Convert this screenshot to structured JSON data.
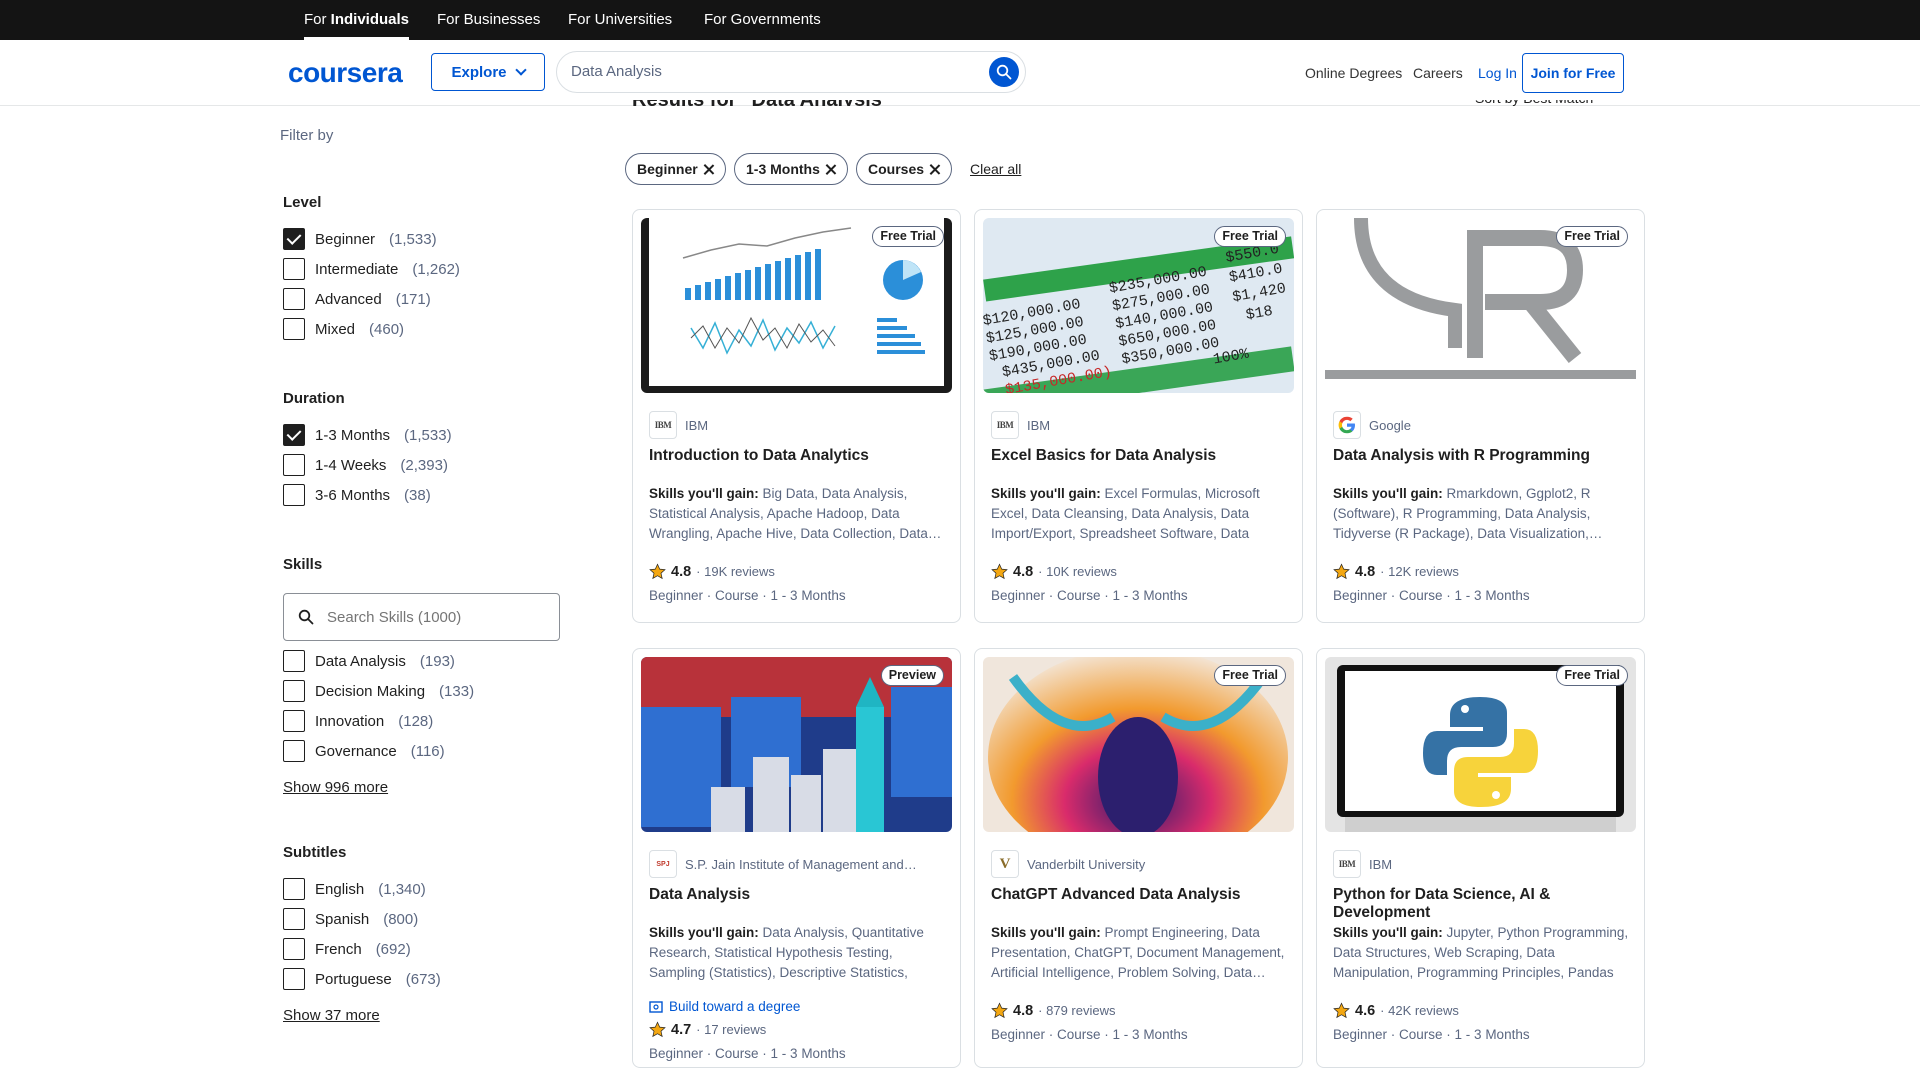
{
  "audience_tabs": [
    {
      "prefix": "For ",
      "bold": "Individuals"
    },
    {
      "label": "For Businesses"
    },
    {
      "label": "For Universities"
    },
    {
      "label": "For Governments"
    }
  ],
  "header": {
    "logo": "coursera",
    "explore": "Explore",
    "search_value": "Data Analysis",
    "links": [
      "Online Degrees",
      "Careers",
      "Log In"
    ],
    "join": "Join for Free"
  },
  "results": {
    "title": "Results for \"Data Analysis\"",
    "sort": "Sort by Best Match"
  },
  "sidebar": {
    "filter_by": "Filter by",
    "level": {
      "title": "Level",
      "options": [
        {
          "label": "Beginner",
          "count": "(1,533)",
          "checked": true
        },
        {
          "label": "Intermediate",
          "count": "(1,262)",
          "checked": false
        },
        {
          "label": "Advanced",
          "count": "(171)",
          "checked": false
        },
        {
          "label": "Mixed",
          "count": "(460)",
          "checked": false
        }
      ]
    },
    "duration": {
      "title": "Duration",
      "options": [
        {
          "label": "1-3 Months",
          "count": "(1,533)",
          "checked": true
        },
        {
          "label": "1-4 Weeks",
          "count": "(2,393)",
          "checked": false
        },
        {
          "label": "3-6 Months",
          "count": "(38)",
          "checked": false
        }
      ]
    },
    "skills": {
      "title": "Skills",
      "search_placeholder": "Search Skills (1000)",
      "options": [
        {
          "label": "Data Analysis",
          "count": "(193)",
          "checked": false
        },
        {
          "label": "Decision Making",
          "count": "(133)",
          "checked": false
        },
        {
          "label": "Innovation",
          "count": "(128)",
          "checked": false
        },
        {
          "label": "Governance",
          "count": "(116)",
          "checked": false
        }
      ],
      "show_more": "Show 996 more"
    },
    "subtitles": {
      "title": "Subtitles",
      "options": [
        {
          "label": "English",
          "count": "(1,340)",
          "checked": false
        },
        {
          "label": "Spanish",
          "count": "(800)",
          "checked": false
        },
        {
          "label": "French",
          "count": "(692)",
          "checked": false
        },
        {
          "label": "Portuguese",
          "count": "(673)",
          "checked": false
        }
      ],
      "show_more": "Show 37 more"
    }
  },
  "chips": [
    "Beginner",
    "1-3 Months",
    "Courses"
  ],
  "clear_all": "Clear all",
  "cards": [
    {
      "badge": "Free Trial",
      "partner": "IBM",
      "partner_logo": "IBM",
      "title": "Introduction to Data Analytics",
      "skills_label": "Skills you'll gain:",
      "skills": "Big Data, Data Analysis, Statistical Analysis, Apache Hadoop, Data Wrangling, Apache Hive, Data Collection, Data…",
      "rating": "4.8",
      "reviews": "· 19K reviews",
      "meta": "Beginner · Course · 1 - 3 Months",
      "thumb": "analytics-dashboard"
    },
    {
      "badge": "Free Trial",
      "partner": "IBM",
      "partner_logo": "IBM",
      "title": "Excel Basics for Data Analysis",
      "skills_label": "Skills you'll gain:",
      "skills": "Excel Formulas, Microsoft Excel, Data Cleansing, Data Analysis, Data Import/Export, Spreadsheet Software, Data Wrangling, Data…",
      "rating": "4.8",
      "reviews": "· 10K reviews",
      "meta": "Beginner · Course · 1 - 3 Months",
      "thumb": "spreadsheet"
    },
    {
      "badge": "Free Trial",
      "partner": "Google",
      "partner_logo": "G",
      "title": "Data Analysis with R Programming",
      "skills_label": "Skills you'll gain:",
      "skills": "Rmarkdown, Ggplot2, R (Software), R Programming, Data Analysis, Tidyverse (R Package), Data Visualization,…",
      "rating": "4.8",
      "reviews": "· 12K reviews",
      "meta": "Beginner · Course · 1 - 3 Months",
      "thumb": "r-logo"
    },
    {
      "badge": "Preview",
      "partner": "S.P. Jain Institute of Management and…",
      "partner_logo": "SPJ",
      "title": "Data Analysis",
      "skills_label": "Skills you'll gain:",
      "skills": "Data Analysis, Quantitative Research, Statistical Hypothesis Testing, Sampling (Statistics), Descriptive Statistics, Business…",
      "degree": "Build toward a degree",
      "rating": "4.7",
      "reviews": "· 17 reviews",
      "meta": "Beginner · Course · 1 - 3 Months",
      "thumb": "blocks"
    },
    {
      "badge": "Free Trial",
      "partner": "Vanderbilt University",
      "partner_logo": "V",
      "title": "ChatGPT Advanced Data Analysis",
      "skills_label": "Skills you'll gain:",
      "skills": "Prompt Engineering, Data Presentation, ChatGPT, Document Management, Artificial Intelligence, Problem Solving, Data…",
      "rating": "4.8",
      "reviews": "· 879 reviews",
      "meta": "Beginner · Course · 1 - 3 Months",
      "thumb": "abstract"
    },
    {
      "badge": "Free Trial",
      "partner": "IBM",
      "partner_logo": "IBM",
      "title": "Python for Data Science, AI & Development",
      "skills_label": "Skills you'll gain:",
      "skills": "Jupyter, Python Programming, Data Structures, Web Scraping, Data Manipulation, Programming Principles, Pandas (Python…",
      "rating": "4.6",
      "reviews": "· 42K reviews",
      "meta": "Beginner · Course · 1 - 3 Months",
      "thumb": "python"
    }
  ]
}
